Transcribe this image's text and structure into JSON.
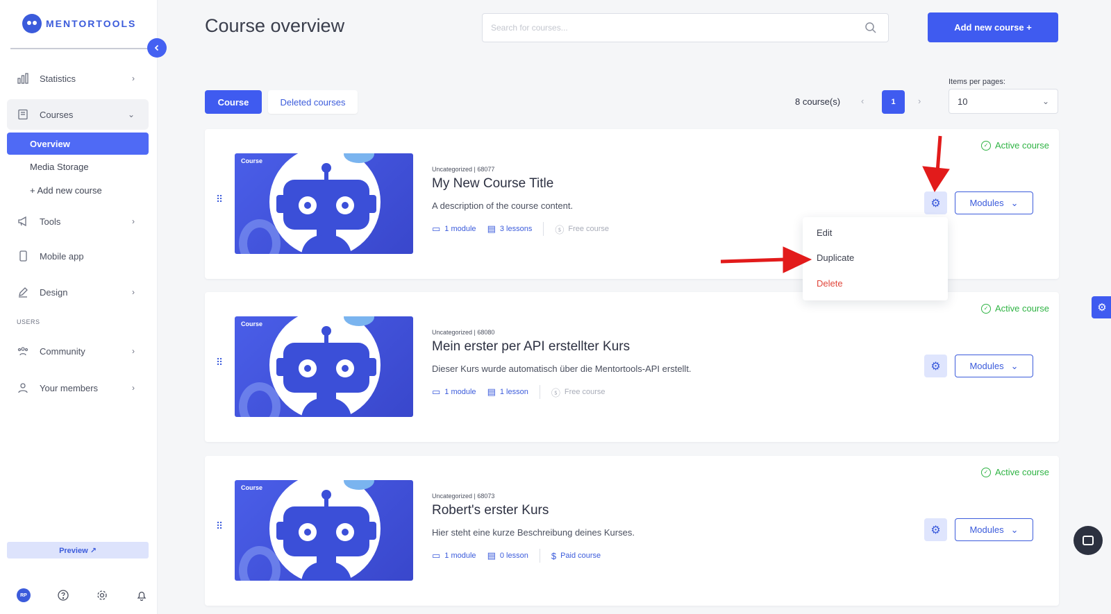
{
  "brand": {
    "name": "MENTORTOOLS"
  },
  "sidebar": {
    "items": [
      {
        "label": "Statistics",
        "icon": "bar-chart-icon"
      },
      {
        "label": "Courses",
        "icon": "book-icon"
      },
      {
        "label": "Tools",
        "icon": "megaphone-icon"
      },
      {
        "label": "Mobile app",
        "icon": "phone-icon"
      },
      {
        "label": "Design",
        "icon": "pencil-icon"
      },
      {
        "label": "Community",
        "icon": "people-icon"
      },
      {
        "label": "Your members",
        "icon": "user-icon"
      }
    ],
    "courses_sub": [
      {
        "label": "Overview"
      },
      {
        "label": "Media Storage"
      },
      {
        "label": "+ Add new course"
      }
    ],
    "users_section": "USERS",
    "preview_label": "Preview ↗",
    "avatar_initials": "RP"
  },
  "header": {
    "title": "Course overview",
    "search_placeholder": "Search for courses...",
    "add_button": "Add new course  +"
  },
  "toolbar": {
    "tab_course": "Course",
    "tab_deleted": "Deleted courses",
    "course_count": "8 course(s)",
    "current_page": "1",
    "items_per_page_label": "Items per pages:",
    "items_per_page_value": "10"
  },
  "courses": [
    {
      "thumb_label": "Course",
      "meta": "Uncategorized | 68077",
      "title": "My New Course Title",
      "description": "A description of the course content.",
      "modules": "1 module",
      "lessons": "3 lessons",
      "price": "Free course",
      "status": "Active course",
      "modules_btn": "Modules"
    },
    {
      "thumb_label": "Course",
      "meta": "Uncategorized | 68080",
      "title": "Mein erster per API erstellter Kurs",
      "description": "Dieser Kurs wurde automatisch über die Mentortools-API erstellt.",
      "modules": "1 module",
      "lessons": "1 lesson",
      "price": "Free course",
      "status": "Active course",
      "modules_btn": "Modules"
    },
    {
      "thumb_label": "Course",
      "meta": "Uncategorized | 68073",
      "title": "Robert's erster Kurs",
      "description": "Hier steht eine kurze Beschreibung deines Kurses.",
      "modules": "1 module",
      "lessons": "0 lesson",
      "price": "Paid course",
      "status": "Active course",
      "modules_btn": "Modules"
    }
  ],
  "dropdown": {
    "edit": "Edit",
    "duplicate": "Duplicate",
    "delete": "Delete"
  },
  "colors": {
    "accent": "#3f5bf0",
    "active_green": "#2fb344",
    "delete_red": "#e0453a",
    "annotation_arrow": "#e21b1b"
  }
}
